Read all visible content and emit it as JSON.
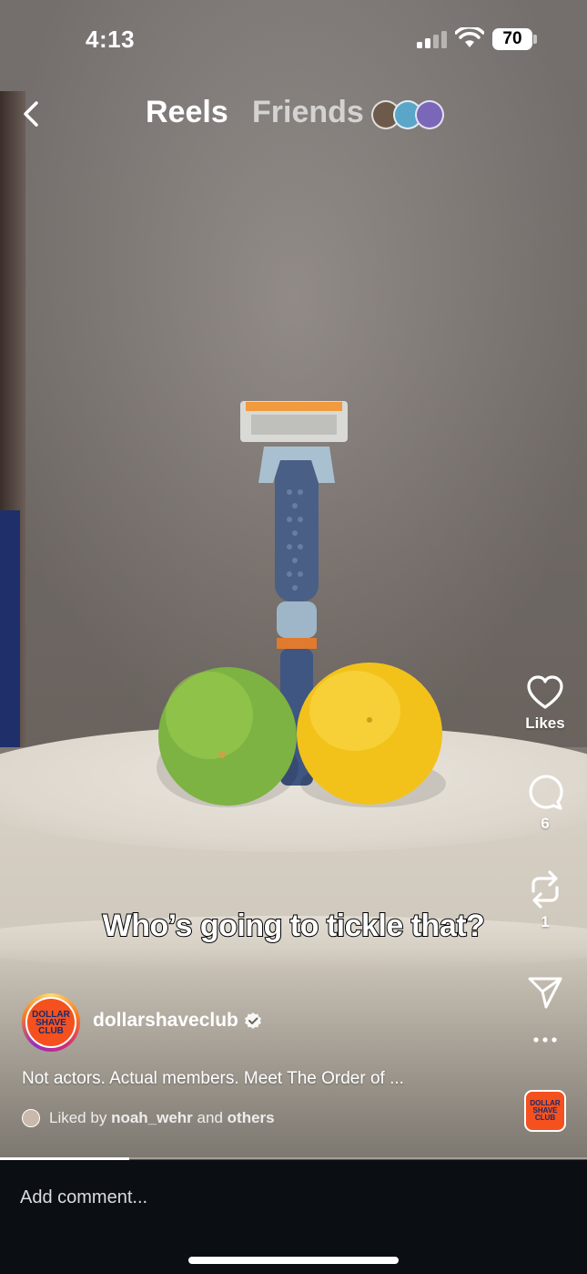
{
  "status_bar": {
    "time": "4:13",
    "battery": "70"
  },
  "nav": {
    "tab_active": "Reels",
    "tab_inactive": "Friends"
  },
  "actions": {
    "likes_label": "Likes",
    "comments_count": "6",
    "reposts_count": "1"
  },
  "video": {
    "subtitle": "Who’s going to tickle that?"
  },
  "post": {
    "username": "dollarshaveclub",
    "logo_text": "DOLLAR SHAVE CLUB",
    "caption": "Not actors. Actual members. Meet The Order of ...",
    "liked_prefix": "Liked by",
    "liked_user": "noah_wehr",
    "liked_and": "and",
    "liked_others": "others"
  },
  "progress": {
    "fraction": 0.22
  },
  "comment": {
    "placeholder": "Add comment..."
  },
  "colors": {
    "brand_orange": "#f4511e",
    "brand_navy": "#1a2a6c",
    "bottom_bar": "#0b0f14"
  }
}
